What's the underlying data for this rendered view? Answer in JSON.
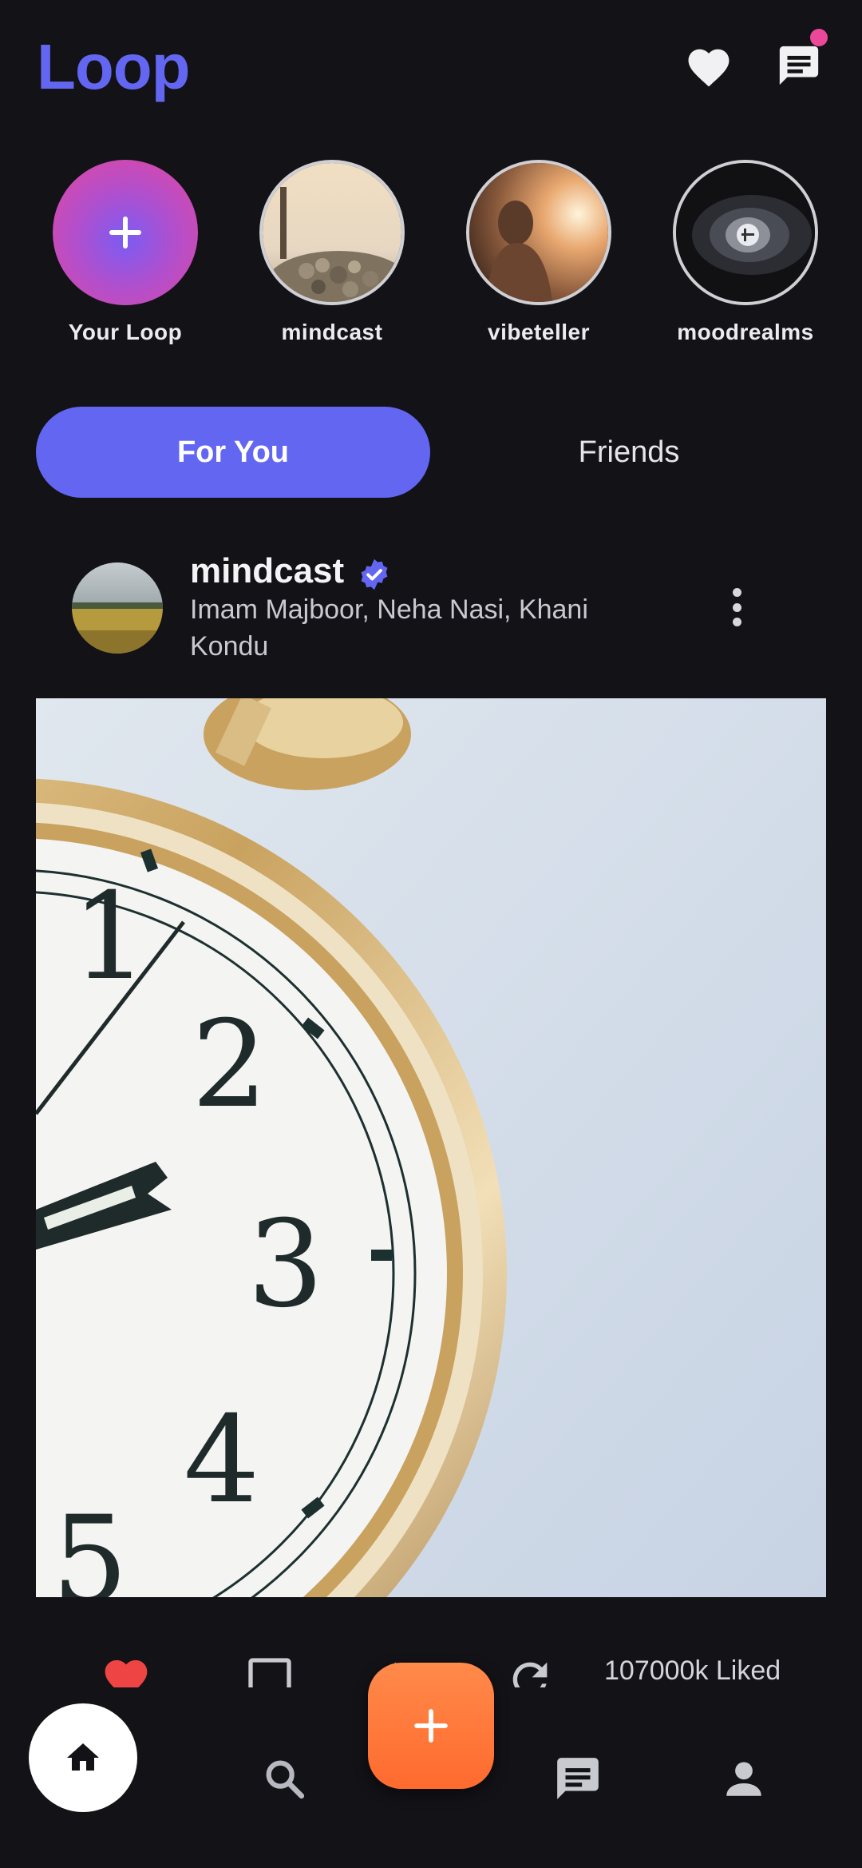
{
  "app": {
    "title": "Loop"
  },
  "colors": {
    "accent": "#6366f1",
    "fab": "#ff6f34",
    "like": "#ef4444",
    "notification": "#ec4899",
    "background": "#121217"
  },
  "header": {
    "icons": [
      "heart-icon",
      "chat-icon"
    ],
    "notification_dot": true
  },
  "stories": [
    {
      "label": "Your Loop",
      "type": "add",
      "icon": "plus-icon"
    },
    {
      "label": "mindcast",
      "type": "avatar"
    },
    {
      "label": "vibeteller",
      "type": "avatar"
    },
    {
      "label": "moodrealms",
      "type": "avatar"
    }
  ],
  "tabs": [
    {
      "label": "For You",
      "active": true
    },
    {
      "label": "Friends",
      "active": false
    }
  ],
  "post": {
    "username": "mindcast",
    "verified": true,
    "subtitle": "Imam Majboor, Neha Nasi, Khani Kondu",
    "likes_text": "107000k Liked",
    "actions": [
      "like-icon",
      "comment-icon",
      "share-icon",
      "repost-icon"
    ]
  },
  "bottom_nav": {
    "items": [
      "home-icon",
      "search-icon",
      "add-icon",
      "messages-icon",
      "profile-icon"
    ],
    "active": "home-icon"
  }
}
